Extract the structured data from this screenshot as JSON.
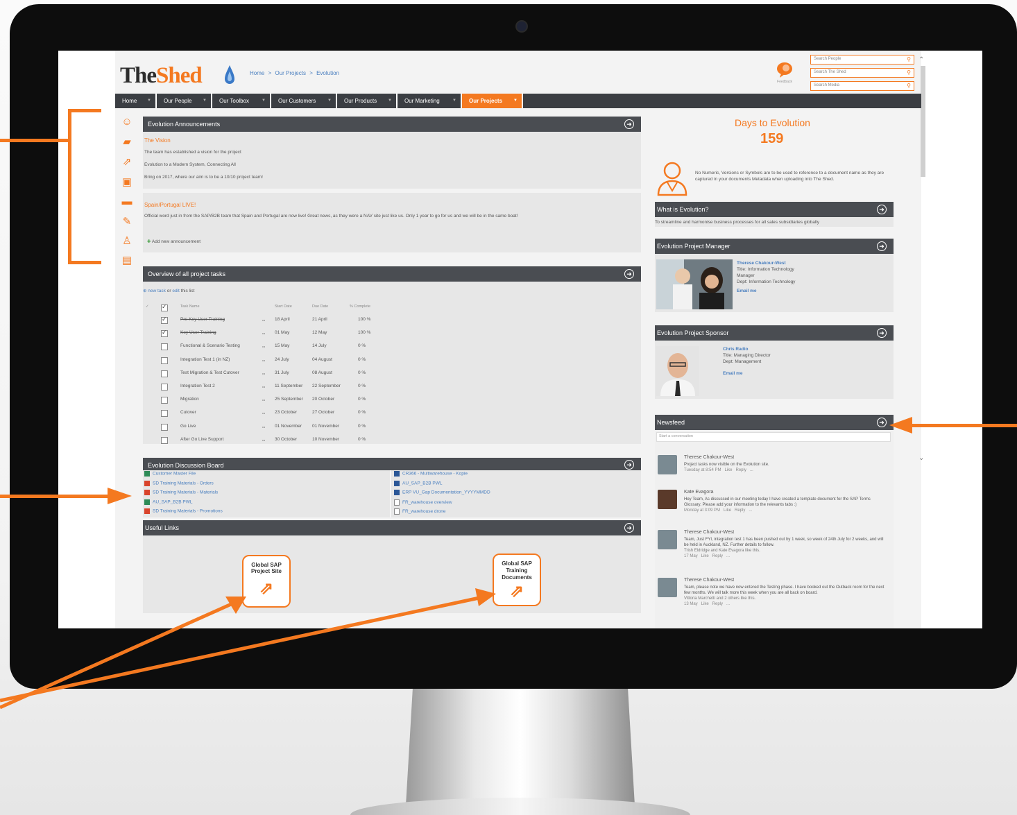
{
  "header": {
    "logo_part1": "The",
    "logo_part2": "Shed",
    "breadcrumb": [
      "Home",
      ">",
      "Our Projects",
      ">",
      "Evolution"
    ],
    "feedback_label": "Feedback",
    "search_people_placeholder": "Search People",
    "search_shed_placeholder": "Search The Shed",
    "search_media_placeholder": "Search Media"
  },
  "nav": {
    "items": [
      "Home",
      "Our People",
      "Our Toolbox",
      "Our Customers",
      "Our Products",
      "Our Marketing",
      "Our Projects"
    ],
    "active": "Our Projects"
  },
  "left_icons": [
    "people-icon",
    "folder-icon",
    "external-link-icon",
    "briefcase-icon",
    "chat-icon",
    "tools-icon",
    "user-icon",
    "clipboard-icon"
  ],
  "announcements": {
    "title": "Evolution Announcements",
    "items": [
      {
        "heading": "The Vision",
        "lines": [
          "The team has established a vision for the project",
          "Evolution to a Modern System, Connecting All",
          "Bring on 2017, where our aim is to be a 10/10 project team!"
        ]
      },
      {
        "heading": "Spain/Portugal LIVE!",
        "lines": [
          "Official word just in from the SAP/B2B team that Spain and Portugal are now live!  Great news, as they were a NAV site just like us.  Only 1 year to go for us and we will be in the same boat!"
        ]
      }
    ],
    "add_label": "Add new announcement"
  },
  "tasks": {
    "title": "Overview of all project tasks",
    "new_task": "new task",
    "or_label": "or",
    "edit_label": "edit",
    "this_list": "this list",
    "columns": [
      "Task Name",
      "Start Date",
      "Due Date",
      "% Complete"
    ],
    "rows": [
      {
        "name": "Pre-Key User Training",
        "start": "18 April",
        "due": "21 April",
        "pct": "100 %",
        "done": true
      },
      {
        "name": "Key User Training",
        "start": "01 May",
        "due": "12 May",
        "pct": "100 %",
        "done": true
      },
      {
        "name": "Functional & Scenario Testing",
        "start": "15 May",
        "due": "14 July",
        "pct": "0 %",
        "done": false
      },
      {
        "name": "Integration Test 1 (in NZ)",
        "start": "24 July",
        "due": "04 August",
        "pct": "0 %",
        "done": false
      },
      {
        "name": "Test Migration & Test Cutover",
        "start": "31 July",
        "due": "08 August",
        "pct": "0 %",
        "done": false
      },
      {
        "name": "Integration Test 2",
        "start": "11 September",
        "due": "22 September",
        "pct": "0 %",
        "done": false
      },
      {
        "name": "Migration",
        "start": "25 September",
        "due": "20 October",
        "pct": "0 %",
        "done": false
      },
      {
        "name": "Cutover",
        "start": "23 October",
        "due": "27 October",
        "pct": "0 %",
        "done": false
      },
      {
        "name": "Go Live",
        "start": "01 November",
        "due": "01 November",
        "pct": "0 %",
        "done": false
      },
      {
        "name": "After Go Live Support",
        "start": "30 October",
        "due": "10 November",
        "pct": "0 %",
        "done": false
      }
    ]
  },
  "discussion": {
    "title": "Evolution Discussion Board",
    "left_files": [
      {
        "name": "Customer Master File",
        "type": "excel"
      },
      {
        "name": "SD Training Materials - Orders",
        "type": "pdf"
      },
      {
        "name": "SD Training Materials - Materials",
        "type": "pdf"
      },
      {
        "name": "AU_SAP_B2B PWL",
        "type": "excel"
      },
      {
        "name": "SD Training Materials - Promotions",
        "type": "pdf"
      }
    ],
    "right_files": [
      {
        "name": "CR366 - Multiwarehouse - Kopie",
        "type": "word"
      },
      {
        "name": "AU_SAP_B2B PWL",
        "type": "word"
      },
      {
        "name": "ERP VU_Gap Documentation_YYYYMMDD",
        "type": "word"
      },
      {
        "name": "FR_warehouse overview",
        "type": "file"
      },
      {
        "name": "FR_warehouse drone",
        "type": "file"
      }
    ]
  },
  "useful_links": {
    "title": "Useful Links",
    "tiles": [
      {
        "label": "Global SAP Project Site"
      },
      {
        "label": "Global SAP Training Documents"
      }
    ]
  },
  "countdown": {
    "label": "Days to Evolution",
    "value": "159",
    "note": "No Numeric, Versions or Symbols are to be used to reference to a document name as they are captured in your documents Metadata when uploading into The Shed."
  },
  "what_is": {
    "title": "What is Evolution?",
    "text": "To streamline and harmonise business processes for all sales subsidiaries globally"
  },
  "manager": {
    "title": "Evolution Project Manager",
    "name": "Therese Chakour-West",
    "title_line": "Title: Information Technology Manager",
    "dept_line": "Dept: Information Technology",
    "email": "Email me"
  },
  "sponsor": {
    "title": "Evolution Project Sponsor",
    "name": "Chris Radio",
    "title_line": "Title: Managing Director",
    "dept_line": "Dept: Management",
    "email": "Email me"
  },
  "newsfeed": {
    "title": "Newsfeed",
    "placeholder": "Start a conversation",
    "posts": [
      {
        "name": "Therese Chakour-West",
        "text": "Project tasks now visible on the Evolution site.",
        "meta": "Tuesday at 8:54 PM   Like   Reply   ..."
      },
      {
        "name": "Kate Evagora",
        "text": "Hey Team, As discussed in our meeting today I have created a template document for the SAP Terms Glossary. Please add your information to the relevants tabs :)",
        "meta": "Monday at 3:09 PM   Like   Reply   ..."
      },
      {
        "name": "Therese Chakour-West",
        "text": "Team, Just FYI, integration test 1 has been pushed out by 1 week, so week of 24th July for 2 weeks, and will be held in Auckland, NZ. Further details to follow.",
        "likes": "Trish Eldridge and Kate Evagora like this.",
        "meta": "17 May   Like   Reply   ..."
      },
      {
        "name": "Therese Chakour-West",
        "text": "Team, please note we have now entered the Testing phase. I have booked out the Outback room for the next few months. We will talk more this week when you are all back on board.",
        "likes": "Vittoria Marchetti and 2 others like this.",
        "meta": "13 May   Like   Reply   ..."
      }
    ]
  },
  "colors": {
    "accent": "#f47920",
    "dark_header": "#4a4d52",
    "nav": "#3b3e43",
    "link": "#4a7fbf"
  }
}
